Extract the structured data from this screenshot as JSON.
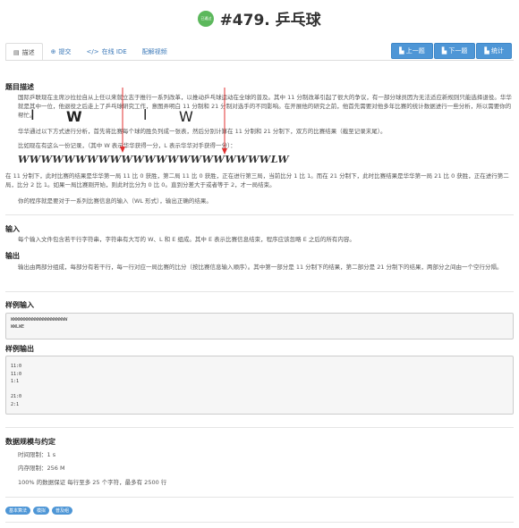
{
  "header": {
    "badge_text": "已通过",
    "title": "#479. 乒乓球"
  },
  "tabs": [
    {
      "label": "描述",
      "icon": "document-icon"
    },
    {
      "label": "提交",
      "icon": "upload-icon"
    },
    {
      "label": "在线 IDE",
      "icon": "code-icon"
    },
    {
      "label": "配解视频",
      "icon": "video-icon"
    }
  ],
  "nav_buttons": {
    "prev": "上一题",
    "next": "下一题",
    "stats": "统计"
  },
  "sections": {
    "description_title": "题目描述",
    "input_title": "输入",
    "output_title": "输出",
    "sample_input_title": "样例输入",
    "sample_output_title": "样例输出",
    "limits_title": "数据规模与约定"
  },
  "description": {
    "p1": "国际乒联现在主席沙拉拉自从上任以来就立志于推行一系列改革，以推动乒乓球运动在全球的普及。其中 11 分制改革引起了很大的争议，有一部分球员因为无法适应新规则只能选择退役。华华就是其中一位，他退役之后走上了乒乓球研究工作，意图弄明白 11 分制和 21 分制对选手的不同影响。在开展他的研究之前，他首先需要对他多年比赛的统计数据进行一些分析，所以需要你的帮忙。",
    "p2": "华华通过以下方式进行分析，首先将比赛每个球的胜负列成一张表，然后分别计算在 11 分制和 21 分制下，双方的比赛结果（截至记录末尾）。",
    "p3": "比如现在有这么一份记录，（其中 W 表示华华获得一分，L 表示华华对手获得一分）：",
    "sequence": "WWWWWWWWWWWWWWWWWWWWWWLW",
    "p4": "在 11 分制下，此时比赛的结果是华华第一局 11 比 0 获胜，第二局 11 比 0 获胜，正在进行第三局，当前比分 1 比 1。而在 21 分制下，此时比赛结果是华华第一局 21 比 0 获胜，正在进行第二局，比分 2 比 1。如果一局比赛刚开始，则此时比分为 0 比 0。直到分差大于或者等于 2，才一局结束。",
    "p5": "你的程序就是要对于一系列比赛信息的输入（WL 形式），输出正确的结果。"
  },
  "input_text": "每个输入文件包含若干行字符串，字符串有大写的 W、L 和 E 组成。其中 E 表示比赛信息结束，程序应该忽略 E 之后的所有内容。",
  "output_text": "输出由两部分组成，每部分有若干行，每一行对应一局比赛的比分（按比赛信息输入顺序）。其中第一部分是 11 分制下的结果，第二部分是 21 分制下的结果，两部分之间由一个空行分隔。",
  "sample_input": [
    "WWWWWWWWWWWWWWWWWWWWW",
    "WWLWE"
  ],
  "sample_output": [
    "11:0",
    "11:0",
    "1:1",
    "",
    "21:0",
    "2:1"
  ],
  "limits": {
    "time": "时间限制：1 s",
    "memory": "内存限制：256 M",
    "note": "100% 的数据保证 每行至多 25 个字符，最多有 2500 行"
  },
  "tags": [
    "基本算法",
    "模拟",
    "普及组"
  ],
  "annotations": {
    "handwriting": [
      "I",
      "W",
      "l",
      "W"
    ],
    "arrow_color": "#e03030",
    "ink_color": "#222222"
  },
  "colors": {
    "accent": "#4e96d6",
    "badge": "#5cb85c"
  }
}
